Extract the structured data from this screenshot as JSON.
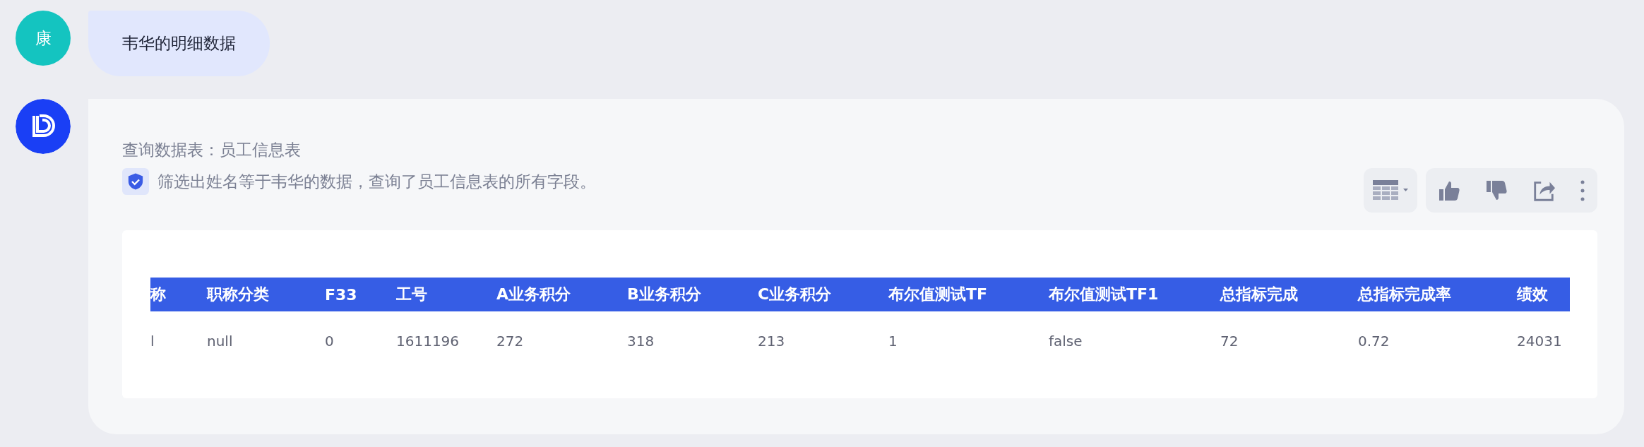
{
  "user_message": {
    "avatar": "康",
    "text": "韦华的明细数据"
  },
  "reply": {
    "query_table": "查询数据表：员工信息表",
    "summary": "筛选出姓名等于韦华的数据，查询了员工信息表的所有字段。",
    "table": {
      "columns": [
        "称",
        "职称分类",
        "F33",
        "工号",
        "A业务积分",
        "B业务积分",
        "C业务积分",
        "布尔值测试TF",
        "布尔值测试TF1",
        "总指标完成",
        "总指标完成率",
        "绩效"
      ],
      "rows": [
        [
          "l",
          "null",
          "0",
          "1611196",
          "272",
          "318",
          "213",
          "1",
          "false",
          "72",
          "0.72",
          "24031"
        ]
      ]
    }
  }
}
